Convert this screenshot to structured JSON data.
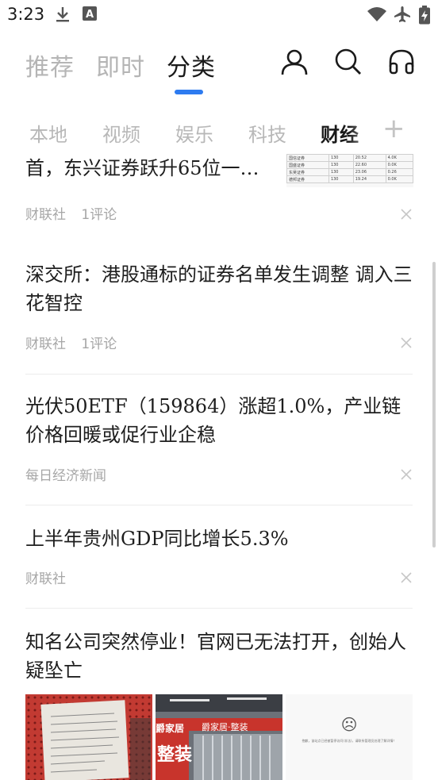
{
  "status_bar": {
    "time": "3:23",
    "icons": [
      "download-icon",
      "keyboard-a-icon",
      "wifi-icon",
      "airplane-icon",
      "battery-charging-icon"
    ]
  },
  "top_tabs": [
    {
      "label": "推荐",
      "active": false
    },
    {
      "label": "即时",
      "active": false
    },
    {
      "label": "分类",
      "active": true
    }
  ],
  "top_actions": [
    "user-icon",
    "search-icon",
    "headphones-icon"
  ],
  "categories": [
    {
      "label": "本地",
      "active": false
    },
    {
      "label": "视频",
      "active": false
    },
    {
      "label": "娱乐",
      "active": false
    },
    {
      "label": "科技",
      "active": false
    },
    {
      "label": "财经",
      "active": true
    }
  ],
  "add_category_label": "+",
  "feed": {
    "items": [
      {
        "title": "首，东兴证券跃升65位一…",
        "source": "财联社",
        "comments": "1评论",
        "has_thumb": true
      },
      {
        "title": "深交所：港股通标的证券名单发生调整 调入三花智控",
        "source": "财联社",
        "comments": "1评论"
      },
      {
        "title": "光伏50ETF（159864）涨超1.0%，产业链价格回暖或促行业企稳",
        "source": "每日经济新闻",
        "comments": ""
      },
      {
        "title": "上半年贵州GDP同比增长5.3%",
        "source": "财联社",
        "comments": ""
      },
      {
        "title": "知名公司突然停业！官网已无法打开，创始人疑坠亡",
        "source": "",
        "comments": ""
      }
    ],
    "thumb_table": {
      "rows": [
        [
          "国信证券",
          "130",
          "20.52",
          "4.0K"
        ],
        [
          "国盛证券",
          "130",
          "22.60",
          "0.0K"
        ],
        [
          "东吴证券",
          "130",
          "23.06",
          "0.26"
        ],
        [
          "德邦证券",
          "130",
          "19.24",
          "0.0K"
        ]
      ]
    },
    "image_text": {
      "banner_a": "爵家居",
      "banner_b": "整装",
      "banner_c": "爵家居·整装",
      "error_face": "☹",
      "error_text": "抱歉，该站点已经被暂停访问(非法)，请联系管理员处理了解详情！"
    }
  }
}
